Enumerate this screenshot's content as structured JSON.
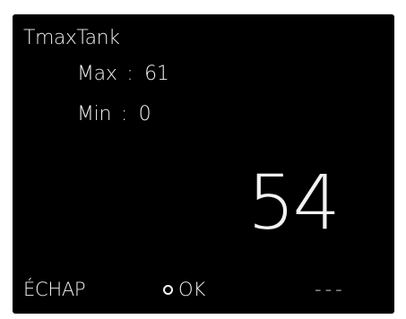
{
  "screen": {
    "title": "TmaxTank",
    "max": {
      "label": "Max",
      "separator": ":",
      "value": "61"
    },
    "min": {
      "label": "Min",
      "separator": ":",
      "value": "0"
    },
    "current_value": "54",
    "footer": {
      "escape_label": "ÉCHAP",
      "ok_label": "OK",
      "more_label": "---"
    }
  }
}
